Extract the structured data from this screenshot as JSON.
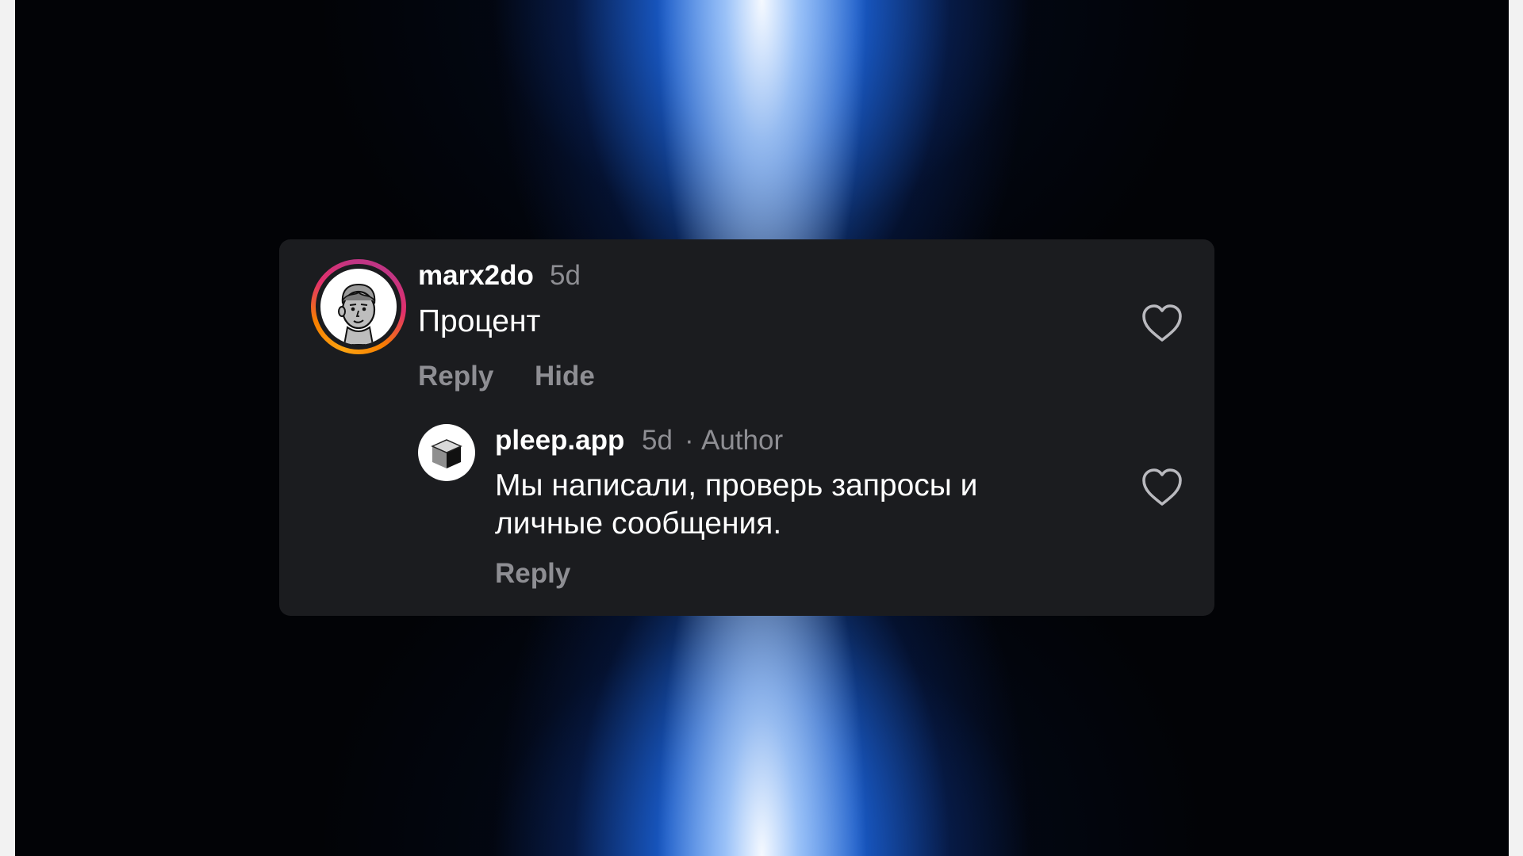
{
  "comment": {
    "username": "marx2do",
    "time": "5d",
    "text": "Процент",
    "actions": {
      "reply": "Reply",
      "hide": "Hide"
    },
    "like_icon": "heart-outline-icon",
    "avatar_ring_colors": [
      "#fca311",
      "#f77f00",
      "#e1306c",
      "#c13584"
    ]
  },
  "reply": {
    "username": "pleep.app",
    "time": "5d",
    "separator": "·",
    "badge": "Author",
    "text_line1": "Мы написали, проверь запросы и",
    "text_line2": "личные сообщения.",
    "actions": {
      "reply": "Reply"
    },
    "like_icon": "heart-outline-icon"
  },
  "colors": {
    "card_bg": "#1b1c1f",
    "primary_text": "#ffffff",
    "secondary_text": "#8e8e93",
    "beam_blue": "#1e6ef0"
  }
}
